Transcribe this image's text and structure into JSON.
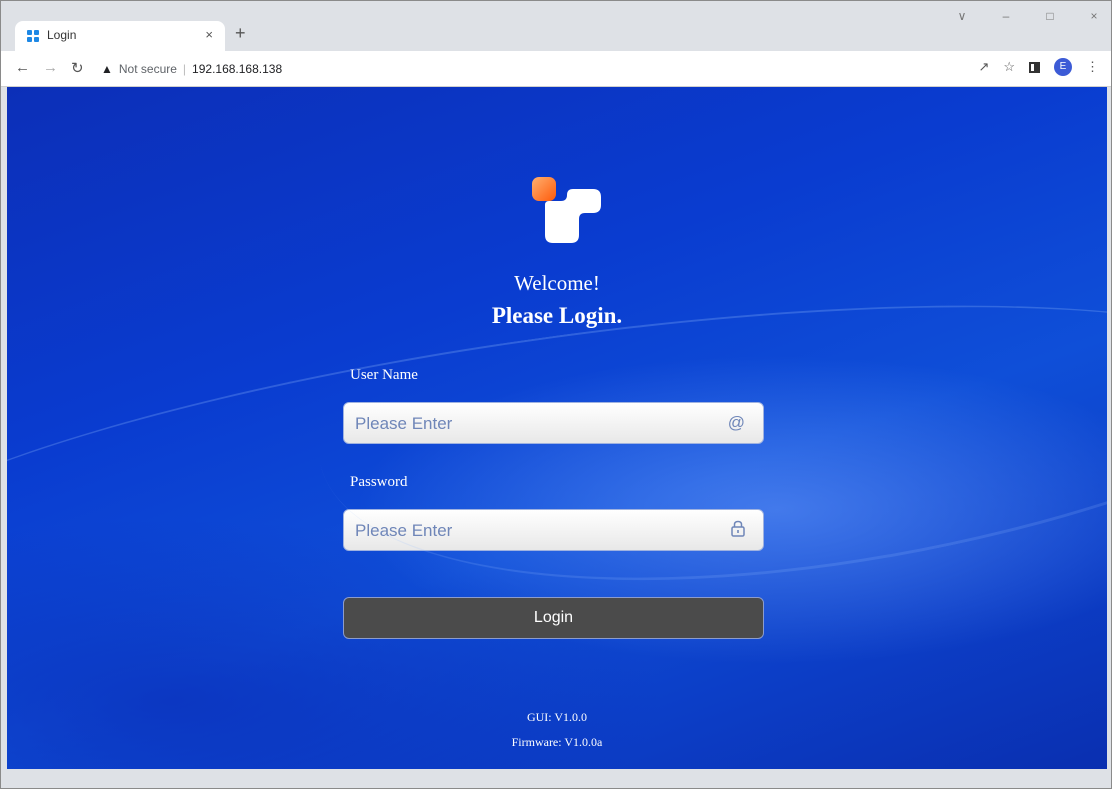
{
  "browser": {
    "tab_title": "Login",
    "tab_close": "×",
    "new_tab": "+",
    "security_text": "Not secure",
    "url": "192.168.168.138",
    "profile_initial": "E",
    "window_controls": [
      "∨",
      "–",
      "□",
      "×"
    ]
  },
  "login": {
    "welcome": "Welcome!",
    "heading": "Please Login.",
    "username_label": "User Name",
    "username_placeholder": "Please Enter",
    "password_label": "Password",
    "password_placeholder": "Please Enter",
    "button_label": "Login"
  },
  "footer": {
    "gui_version": "GUI: V1.0.0",
    "firmware_version": "Firmware: V1.0.0a"
  },
  "icons": {
    "username_field": "at-sign-icon",
    "password_field": "lock-icon"
  },
  "colors": {
    "logo_orange": "#ff6a13",
    "login_button": "#4b4b4b",
    "page_blue": "#0a3cd0"
  }
}
